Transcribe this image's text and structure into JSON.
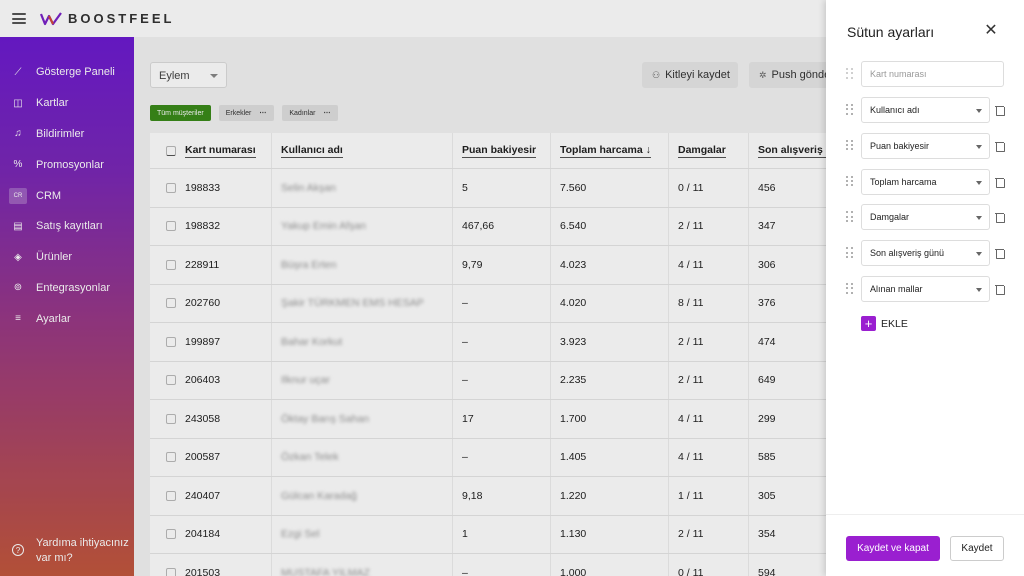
{
  "app": {
    "logo_text": "BOOSTFEEL"
  },
  "sidebar": {
    "items": [
      {
        "label": "Gösterge Paneli",
        "icon": "chart-line-icon"
      },
      {
        "label": "Kartlar",
        "icon": "cards-icon"
      },
      {
        "label": "Bildirimler",
        "icon": "bell-icon"
      },
      {
        "label": "Promosyonlar",
        "icon": "percent-icon"
      },
      {
        "label": "CRM",
        "icon": "crm-icon",
        "active": true,
        "icon_text": "CR\nRM"
      },
      {
        "label": "Satış kayıtları",
        "icon": "document-icon"
      },
      {
        "label": "Ürünler",
        "icon": "box-icon"
      },
      {
        "label": "Entegrasyonlar",
        "icon": "integration-icon"
      },
      {
        "label": "Ayarlar",
        "icon": "sliders-icon"
      }
    ],
    "help_line1": "Yardıma ihtiyacınız",
    "help_line2": "var mı?"
  },
  "toolbar": {
    "action_select": "Eylem",
    "save_audience": "Kitleyi kaydet",
    "push_send": "Push gönde"
  },
  "filters": [
    {
      "label": "Tüm müşteriler",
      "active": true
    },
    {
      "label": "Erkekler"
    },
    {
      "label": "Kadınlar"
    }
  ],
  "table": {
    "headers": [
      "Kart numarası",
      "Kullanıcı adı",
      "Puan bakiyesir",
      "Toplam harcama ↓",
      "Damgalar",
      "Son alışveriş g"
    ],
    "rows": [
      [
        "198833",
        "Selin Akşan",
        "5",
        "7.560",
        "0 / 11",
        "456"
      ],
      [
        "198832",
        "Yakup Emin Afşan",
        "467,66",
        "6.540",
        "2 / 11",
        "347"
      ],
      [
        "228911",
        "Büşra Erten",
        "9,79",
        "4.023",
        "4 / 11",
        "306"
      ],
      [
        "202760",
        "Şakir TÜRKMEN EMS HESAP",
        "–",
        "4.020",
        "8 / 11",
        "376"
      ],
      [
        "199897",
        "Bahar Korkut",
        "–",
        "3.923",
        "2 / 11",
        "474"
      ],
      [
        "206403",
        "Ilknur uçar",
        "–",
        "2.235",
        "2 / 11",
        "649"
      ],
      [
        "243058",
        "Öktay Barış Sahan",
        "17",
        "1.700",
        "4 / 11",
        "299"
      ],
      [
        "200587",
        "Özkan Telek",
        "–",
        "1.405",
        "4 / 11",
        "585"
      ],
      [
        "240407",
        "Gülcan Karadağ",
        "9,18",
        "1.220",
        "1 / 11",
        "305"
      ],
      [
        "204184",
        "Ezgi Sel",
        "1",
        "1.130",
        "2 / 11",
        "354"
      ],
      [
        "201503",
        "MUSTAFA YILMAZ",
        "–",
        "1.000",
        "0 / 11",
        "594"
      ]
    ]
  },
  "panel": {
    "title": "Sütun ayarları",
    "first_placeholder": "Kart numarası",
    "columns": [
      "Kullanıcı adı",
      "Puan bakiyesir",
      "Toplam harcama",
      "Damgalar",
      "Son alışveriş günü",
      "Alınan mallar"
    ],
    "add_label": "EKLE",
    "save_close": "Kaydet ve kapat",
    "save": "Kaydet"
  }
}
